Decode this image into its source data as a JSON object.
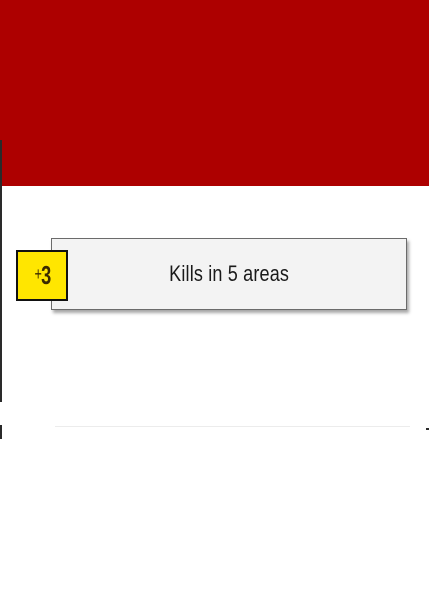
{
  "theme": {
    "header_color": "#ad0000",
    "badge_color": "#ffe600",
    "card_color": "#f3f3f3"
  },
  "achievement": {
    "points_sign": "+",
    "points_value": "3",
    "label": "Kills in 5 areas"
  }
}
